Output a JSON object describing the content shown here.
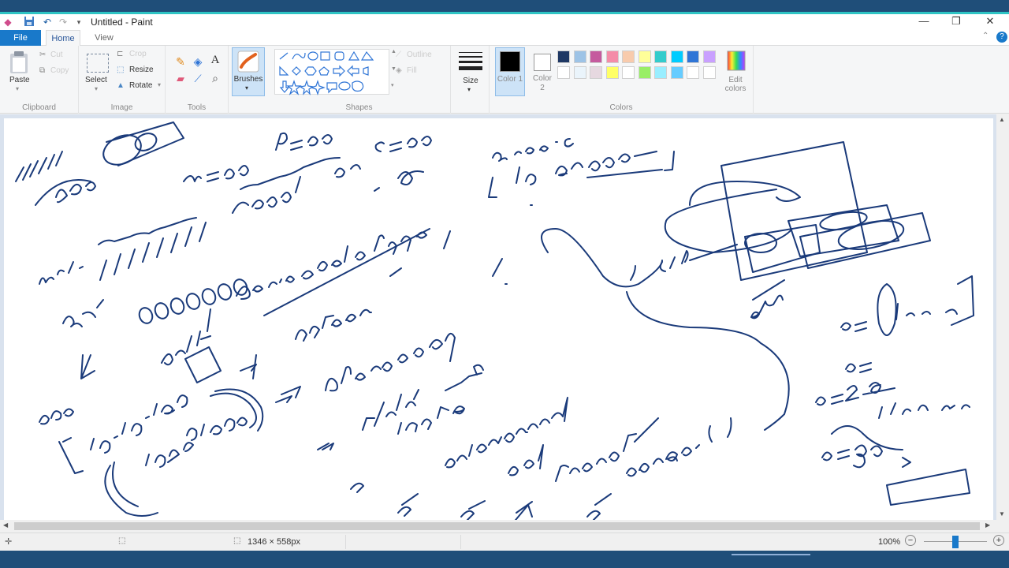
{
  "window": {
    "title": "Untitled - Paint"
  },
  "tabs": {
    "file": "File",
    "home": "Home",
    "view": "View"
  },
  "ribbon": {
    "clipboard": {
      "paste": "Paste",
      "cut": "Cut",
      "copy": "Copy",
      "group": "Clipboard"
    },
    "image": {
      "select": "Select",
      "crop": "Crop",
      "resize": "Resize",
      "rotate": "Rotate",
      "group": "Image"
    },
    "tools": {
      "group": "Tools"
    },
    "brushes": {
      "label": "Brushes"
    },
    "shapes": {
      "outline": "Outline",
      "fill": "Fill",
      "group": "Shapes"
    },
    "size": {
      "label": "Size"
    },
    "colors": {
      "color1": "Color 1",
      "color2": "Color 2",
      "edit": "Edit colors",
      "group": "Colors",
      "color1_value": "#000000",
      "color2_value": "#ffffff",
      "palette_row1": [
        "#1f3864",
        "#9dc3e6",
        "#c55a9e",
        "#f48ca8",
        "#f8cbad",
        "#ffff99",
        "#33cccc",
        "#00ccff",
        "#2f75d6",
        "#c9a0ff"
      ],
      "palette_row2": [
        "#ffffff",
        "#eaf4fb",
        "#e6d8e0",
        "#ffff66",
        "#ffffff",
        "#99ee66",
        "#99eeff",
        "#66ccff",
        "#ffffff",
        "#ffffff"
      ]
    }
  },
  "status": {
    "canvas_size": "1346 × 558px",
    "zoom": "100%",
    "zoom_level": 0.5
  }
}
